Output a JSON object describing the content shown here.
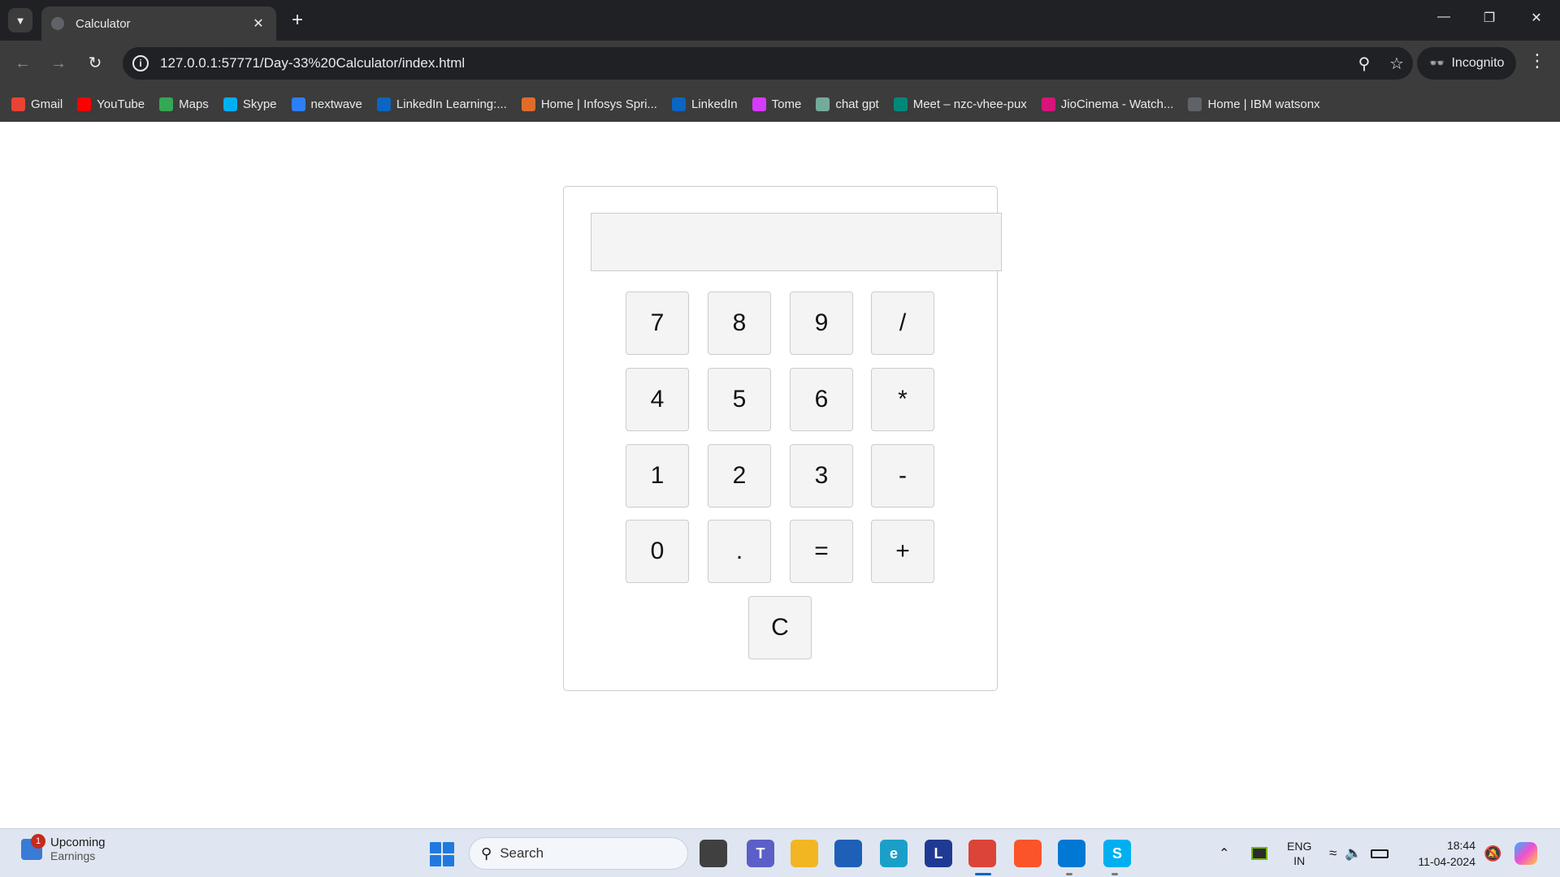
{
  "browser": {
    "tab_title": "Calculator",
    "new_tab_label": "+",
    "tab_close_label": "✕",
    "url": "127.0.0.1:57771/Day-33%20Calculator/index.html",
    "incognito_label": "Incognito",
    "window_controls": {
      "minimize": "—",
      "restore": "❐",
      "close": "✕"
    },
    "bookmarks": [
      {
        "label": "Gmail",
        "icon": "gmail-icon",
        "color": "#ea4335"
      },
      {
        "label": "YouTube",
        "icon": "youtube-icon",
        "color": "#ff0000"
      },
      {
        "label": "Maps",
        "icon": "maps-icon",
        "color": "#34a853"
      },
      {
        "label": "Skype",
        "icon": "skype-icon",
        "color": "#00aff0"
      },
      {
        "label": "nextwave",
        "icon": "nextwave-icon",
        "color": "#2d7ff9"
      },
      {
        "label": "LinkedIn Learning:...",
        "icon": "linkedin-learning-icon",
        "color": "#0a66c2"
      },
      {
        "label": "Home | Infosys Spri...",
        "icon": "infosys-icon",
        "color": "#e06c2b"
      },
      {
        "label": "LinkedIn",
        "icon": "linkedin-icon",
        "color": "#0a66c2"
      },
      {
        "label": "Tome",
        "icon": "tome-icon",
        "color": "#d63aff"
      },
      {
        "label": "chat gpt",
        "icon": "chatgpt-icon",
        "color": "#74aa9c"
      },
      {
        "label": "Meet – nzc-vhee-pux",
        "icon": "meet-icon",
        "color": "#00897b"
      },
      {
        "label": "JioCinema - Watch...",
        "icon": "jiocinema-icon",
        "color": "#d6147a"
      },
      {
        "label": "Home | IBM watsonx",
        "icon": "ibm-watsonx-icon",
        "color": "#5f6368"
      }
    ]
  },
  "calculator": {
    "display_value": "",
    "buttons": [
      {
        "label": "7",
        "row": 0,
        "col": 0
      },
      {
        "label": "8",
        "row": 0,
        "col": 1
      },
      {
        "label": "9",
        "row": 0,
        "col": 2
      },
      {
        "label": "/",
        "row": 0,
        "col": 3
      },
      {
        "label": "4",
        "row": 1,
        "col": 0
      },
      {
        "label": "5",
        "row": 1,
        "col": 1
      },
      {
        "label": "6",
        "row": 1,
        "col": 2
      },
      {
        "label": "*",
        "row": 1,
        "col": 3
      },
      {
        "label": "1",
        "row": 2,
        "col": 0
      },
      {
        "label": "2",
        "row": 2,
        "col": 1
      },
      {
        "label": "3",
        "row": 2,
        "col": 2
      },
      {
        "label": "-",
        "row": 2,
        "col": 3
      },
      {
        "label": "0",
        "row": 3,
        "col": 0
      },
      {
        "label": ".",
        "row": 3,
        "col": 1
      },
      {
        "label": "=",
        "row": 3,
        "col": 2
      },
      {
        "label": "+",
        "row": 3,
        "col": 3
      }
    ],
    "clear_label": "C"
  },
  "taskbar": {
    "widget_title": "Upcoming",
    "widget_subtitle": "Earnings",
    "widget_badge": "1",
    "search_label": "Search",
    "apps": [
      {
        "name": "task-view-icon",
        "color": "#404040",
        "glyph": ""
      },
      {
        "name": "teams-icon",
        "color": "#5b5fc7",
        "glyph": "T"
      },
      {
        "name": "file-explorer-icon",
        "color": "#f2b623",
        "glyph": ""
      },
      {
        "name": "microsoft-store-icon",
        "color": "#1e5fb8",
        "glyph": ""
      },
      {
        "name": "edge-icon",
        "color": "#1aa0c8",
        "glyph": "e"
      },
      {
        "name": "l-app-icon",
        "color": "#1f3a93",
        "glyph": "L"
      },
      {
        "name": "chrome-icon",
        "color": "#db4437",
        "glyph": ""
      },
      {
        "name": "brave-icon",
        "color": "#fb542b",
        "glyph": ""
      },
      {
        "name": "vscode-icon",
        "color": "#0078d4",
        "glyph": ""
      },
      {
        "name": "skype-taskbar-icon",
        "color": "#00aff0",
        "glyph": "S"
      }
    ],
    "language_top": "ENG",
    "language_bottom": "IN",
    "time": "18:44",
    "date": "11-04-2024"
  }
}
